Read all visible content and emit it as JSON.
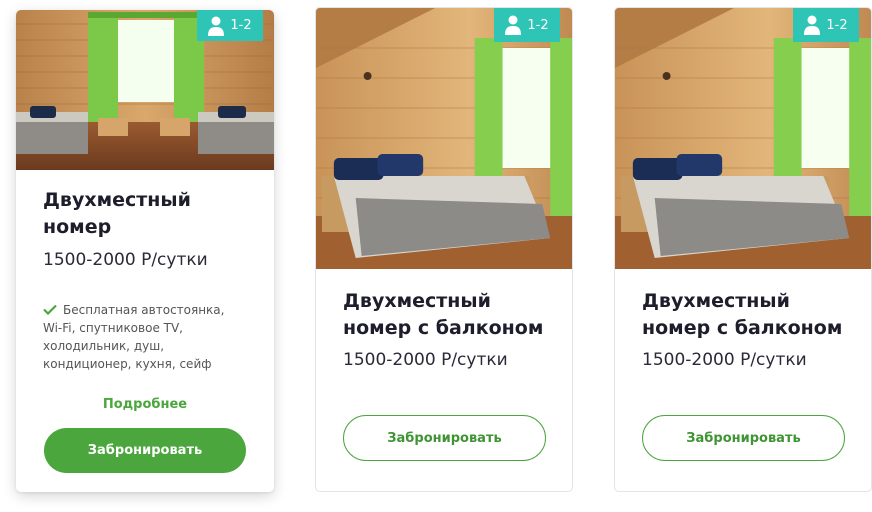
{
  "cards": [
    {
      "badge": "1-2",
      "title": "Двухместный номер",
      "price": "1500-2000 Р/сутки",
      "amenities_line1": "Бесплатная автостоянка,",
      "amenities_rest": [
        "Wi-Fi, спутниковое TV,",
        "холодильник, душ,",
        "кондиционер, кухня, сейф"
      ],
      "more_label": "Подробнее",
      "book_label": "Забронировать"
    },
    {
      "badge": "1-2",
      "title": "Двухместный номер с балконом",
      "price": "1500-2000 Р/сутки",
      "book_label": "Забронировать"
    },
    {
      "badge": "1-2",
      "title": "Двухместный номер с балконом",
      "price": "1500-2000 Р/сутки",
      "book_label": "Забронировать"
    }
  ],
  "colors": {
    "accent": "#4aa63d",
    "badge": "#2ec4b6"
  },
  "icons": {
    "badge_icon": "person-icon",
    "amenity_icon": "check-icon"
  }
}
